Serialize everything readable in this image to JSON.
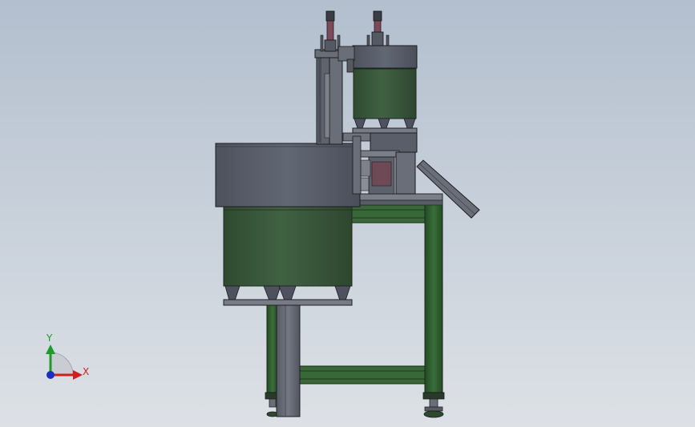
{
  "window": {
    "background_top": "#b3bfce",
    "background_bottom": "#dde1e6"
  },
  "model": {
    "frame_color": "#2f5e2f",
    "hopper_color": "#3b5a3b",
    "lid_color": "#5a5f6b",
    "steel_color": "#6a6e78"
  },
  "triad": {
    "x_label": "X",
    "y_label": "Y",
    "x_color": "#cc1f1f",
    "y_color": "#1f9a2a",
    "z_color": "#1a2fbf"
  }
}
